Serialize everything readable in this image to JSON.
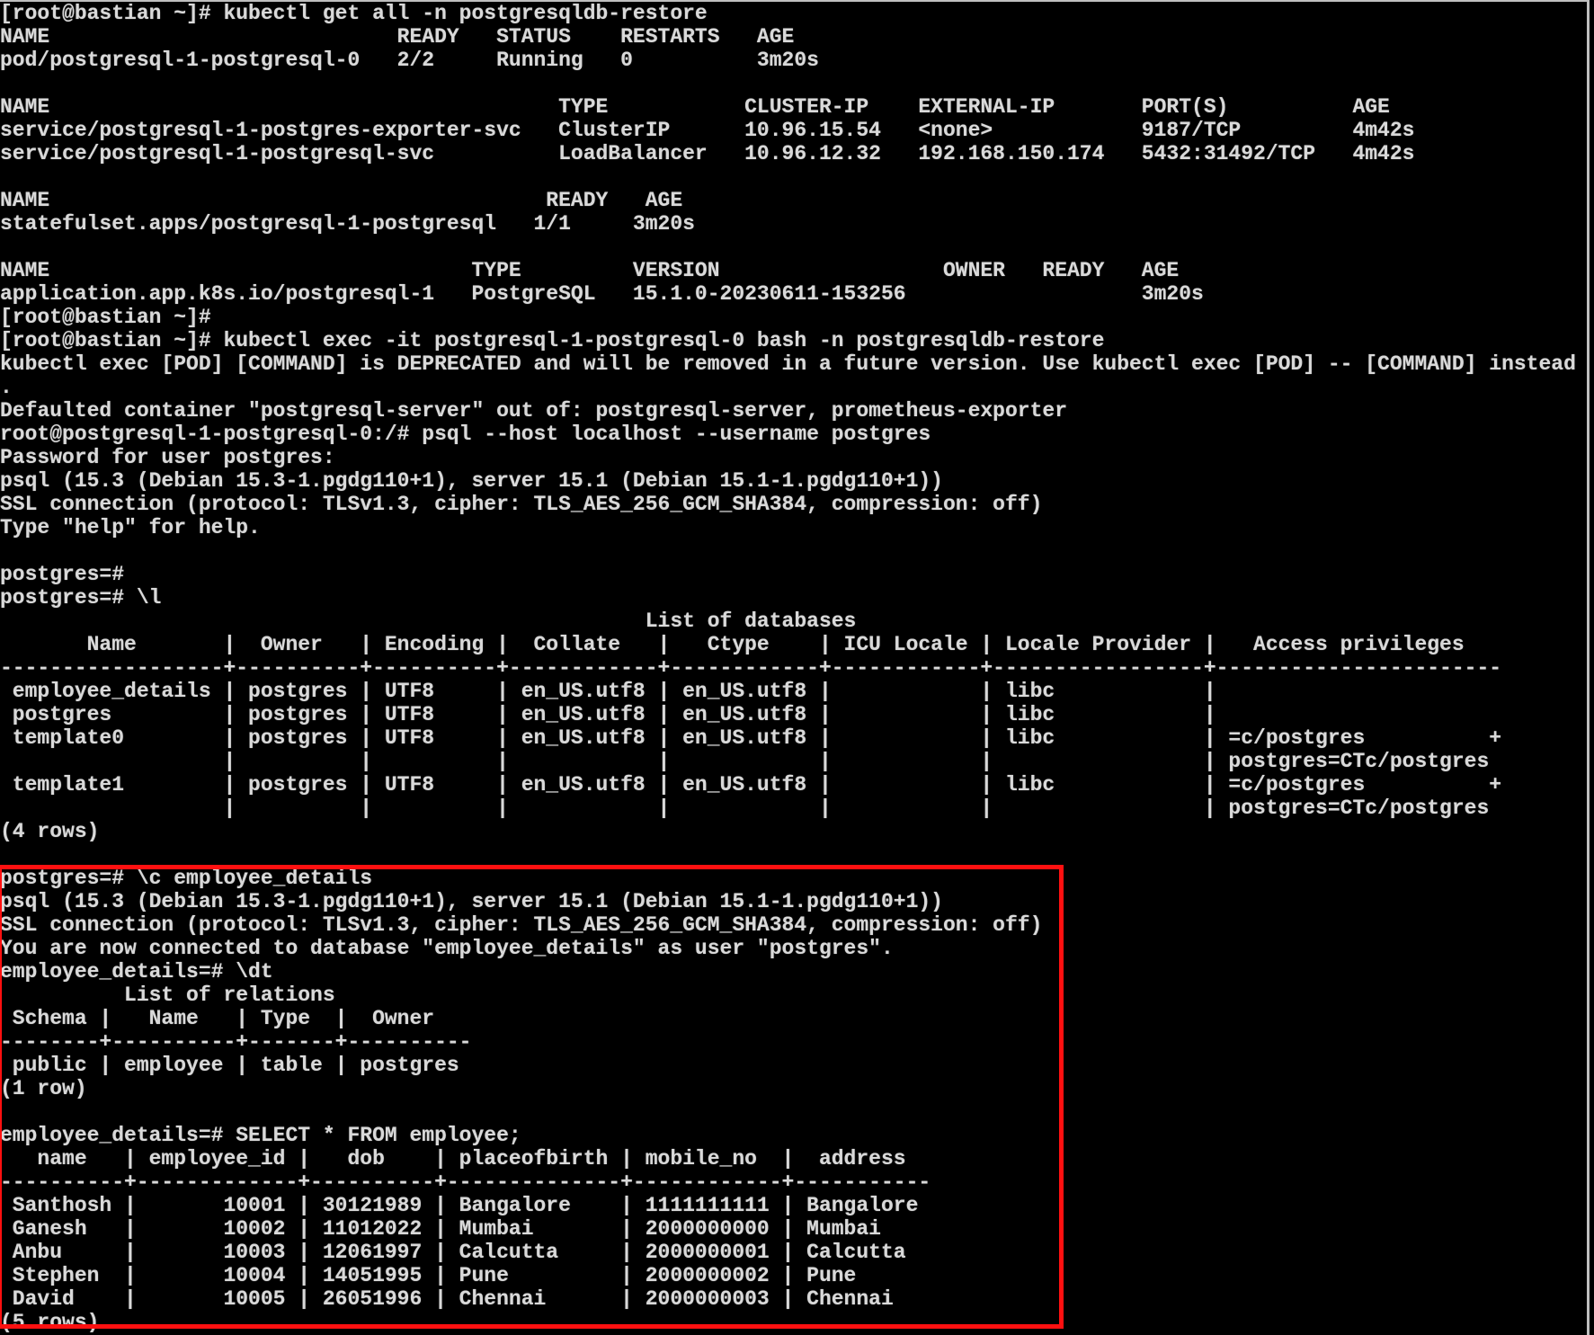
{
  "terminal": {
    "highlight_color": "#ff1010",
    "text_color": "#d9d9d9",
    "background_color": "#000000",
    "lines": [
      "[root@bastian ~]# kubectl get all -n postgresqldb-restore",
      "NAME                            READY   STATUS    RESTARTS   AGE",
      "pod/postgresql-1-postgresql-0   2/2     Running   0          3m20s",
      "",
      "NAME                                         TYPE           CLUSTER-IP    EXTERNAL-IP       PORT(S)          AGE",
      "service/postgresql-1-postgres-exporter-svc   ClusterIP      10.96.15.54   <none>            9187/TCP         4m42s",
      "service/postgresql-1-postgresql-svc          LoadBalancer   10.96.12.32   192.168.150.174   5432:31492/TCP   4m42s",
      "",
      "NAME                                        READY   AGE",
      "statefulset.apps/postgresql-1-postgresql   1/1     3m20s",
      "",
      "NAME                                  TYPE         VERSION                  OWNER   READY   AGE",
      "application.app.k8s.io/postgresql-1   PostgreSQL   15.1.0-20230611-153256                   3m20s",
      "[root@bastian ~]#",
      "[root@bastian ~]# kubectl exec -it postgresql-1-postgresql-0 bash -n postgresqldb-restore",
      "kubectl exec [POD] [COMMAND] is DEPRECATED and will be removed in a future version. Use kubectl exec [POD] -- [COMMAND] instead",
      ".",
      "Defaulted container \"postgresql-server\" out of: postgresql-server, prometheus-exporter",
      "root@postgresql-1-postgresql-0:/# psql --host localhost --username postgres",
      "Password for user postgres:",
      "psql (15.3 (Debian 15.3-1.pgdg110+1), server 15.1 (Debian 15.1-1.pgdg110+1))",
      "SSL connection (protocol: TLSv1.3, cipher: TLS_AES_256_GCM_SHA384, compression: off)",
      "Type \"help\" for help.",
      "",
      "postgres=#",
      "postgres=# \\l",
      "                                                    List of databases",
      "       Name       |  Owner   | Encoding |  Collate   |   Ctype    | ICU Locale | Locale Provider |   Access privileges",
      "------------------+----------+----------+------------+------------+------------+-----------------+-----------------------",
      " employee_details | postgres | UTF8     | en_US.utf8 | en_US.utf8 |            | libc            |",
      " postgres         | postgres | UTF8     | en_US.utf8 | en_US.utf8 |            | libc            |",
      " template0        | postgres | UTF8     | en_US.utf8 | en_US.utf8 |            | libc            | =c/postgres          +",
      "                  |          |          |            |            |            |                 | postgres=CTc/postgres",
      " template1        | postgres | UTF8     | en_US.utf8 | en_US.utf8 |            | libc            | =c/postgres          +",
      "                  |          |          |            |            |            |                 | postgres=CTc/postgres",
      "(4 rows)",
      "",
      "postgres=# \\c employee_details",
      "psql (15.3 (Debian 15.3-1.pgdg110+1), server 15.1 (Debian 15.1-1.pgdg110+1))",
      "SSL connection (protocol: TLSv1.3, cipher: TLS_AES_256_GCM_SHA384, compression: off)",
      "You are now connected to database \"employee_details\" as user \"postgres\".",
      "employee_details=# \\dt",
      "          List of relations",
      " Schema |   Name   | Type  |  Owner",
      "--------+----------+-------+----------",
      " public | employee | table | postgres",
      "(1 row)",
      "",
      "employee_details=# SELECT * FROM employee;",
      "   name   | employee_id |   dob    | placeofbirth | mobile_no  |  address",
      "----------+-------------+----------+--------------+------------+-----------",
      " Santhosh |       10001 | 30121989 | Bangalore    | 1111111111 | Bangalore",
      " Ganesh   |       10002 | 11012022 | Mumbai       | 2000000000 | Mumbai",
      " Anbu     |       10003 | 12061997 | Calcutta     | 2000000001 | Calcutta",
      " Stephen  |       10004 | 14051995 | Pune         | 2000000002 | Pune",
      " David    |       10005 | 26051996 | Chennai      | 2000000003 | Chennai",
      "(5 rows)"
    ]
  }
}
